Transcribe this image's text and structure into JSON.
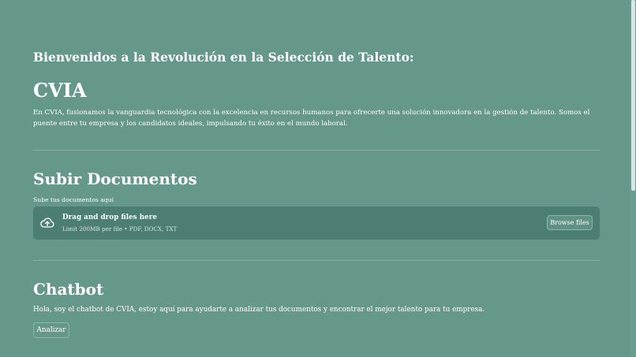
{
  "header": {
    "welcome": "Bienvenidos a la Revolución en la Selección de Talento:",
    "brand": "CVIA",
    "intro": "En CVIA, fusionamos la vanguardia tecnológica con la excelencia en recursos humanos para ofrecerte una solución innovadora en la gestión de talento. Somos el puente entre tu empresa y los candidatos ideales, impulsando tu éxito en el mundo laboral."
  },
  "upload": {
    "title": "Subir Documentos",
    "caption": "Sube tus documentos aquí",
    "drop_label": "Drag and drop files here",
    "limit_text": "Limit 200MB per file • PDF, DOCX, TXT",
    "browse_label": "Browse files",
    "icon": "cloud-upload-icon"
  },
  "chatbot": {
    "title": "Chatbot",
    "text": "Hola, soy el chatbot de CVIA, estoy aquí para ayudarte a analizar tus documentos y encontrar el mejor talento para tu empresa.",
    "analyze_label": "Analizar"
  },
  "colors": {
    "background": "#65988b",
    "dropzone": "#4c7e73",
    "text": "#ffffff",
    "divider": "#86aea4"
  }
}
